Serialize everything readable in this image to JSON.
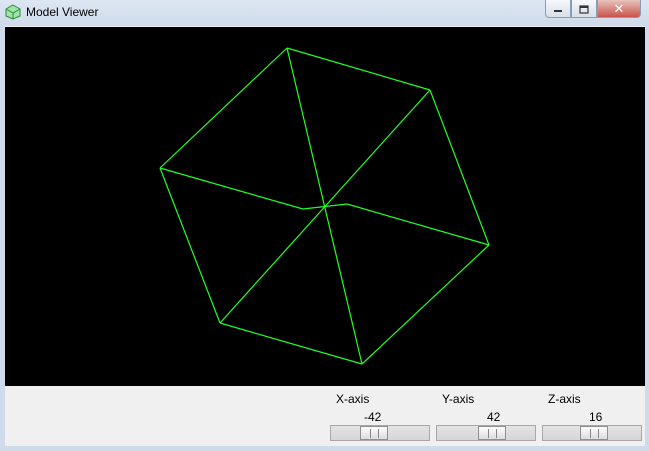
{
  "window": {
    "title": "Model Viewer",
    "icon": "cube-icon",
    "buttons": [
      "minimize-icon",
      "maximize-icon",
      "close-icon"
    ]
  },
  "viewport": {
    "background": "#000000",
    "wire_color": "#22ff22",
    "model": "wireframe cube"
  },
  "controls": {
    "x": {
      "label": "X-axis",
      "value": "-42",
      "slider_fraction": 0.42
    },
    "y": {
      "label": "Y-axis",
      "value": "42",
      "slider_fraction": 0.58
    },
    "z": {
      "label": "Z-axis",
      "value": "16",
      "slider_fraction": 0.53
    }
  }
}
